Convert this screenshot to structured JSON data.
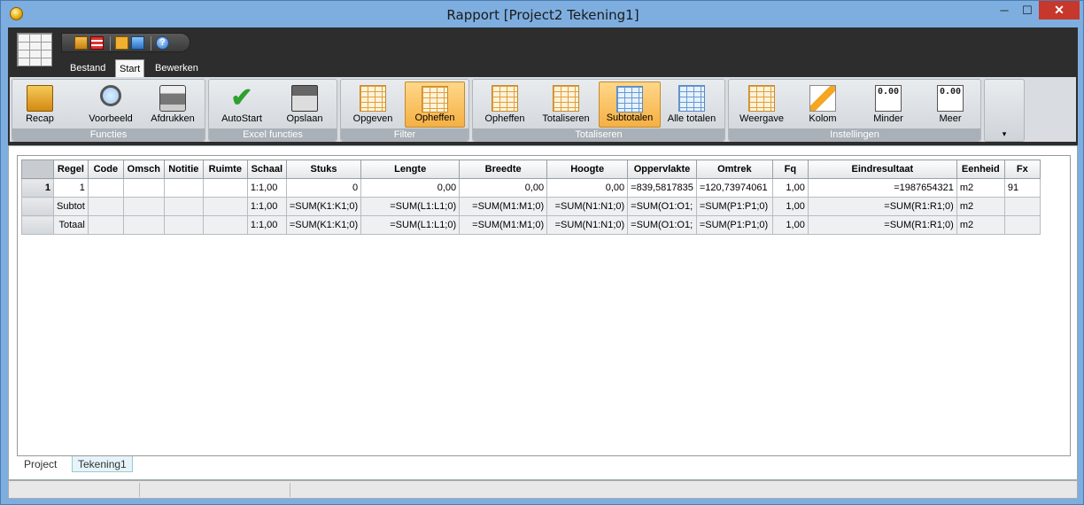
{
  "window": {
    "title": "Rapport  [Project2 Tekening1]",
    "min": "─",
    "max": "☐",
    "close": "✕"
  },
  "tabs": [
    "Bestand",
    "Start",
    "Bewerken"
  ],
  "active_tab": "Start",
  "groups": {
    "functies": {
      "label": "Functies",
      "buttons": [
        "Recap",
        "Voorbeeld",
        "Afdrukken"
      ]
    },
    "excel": {
      "label": "Excel functies",
      "buttons": [
        "AutoStart",
        "Opslaan"
      ]
    },
    "filter": {
      "label": "Filter",
      "buttons": [
        "Opgeven",
        "Opheffen"
      ]
    },
    "totaliseren": {
      "label": "Totaliseren",
      "buttons": [
        "Opheffen",
        "Totaliseren",
        "Subtotalen",
        "Alle totalen"
      ]
    },
    "instellingen": {
      "label": "Instellingen",
      "buttons": [
        "Weergave",
        "Kolom",
        "Minder",
        "Meer"
      ]
    }
  },
  "counter_icon": "0.00",
  "dropdown_arrow": "▾",
  "table": {
    "headers": [
      "",
      "Regel",
      "Code",
      "Omsch",
      "Notitie",
      "Ruimte",
      "Schaal",
      "Stuks",
      "Lengte",
      "Breedte",
      "Hoogte",
      "Oppervlakte",
      "Omtrek",
      "Fq",
      "Eindresultaat",
      "Eenheid",
      "Fx"
    ],
    "rows": [
      [
        "1",
        "1",
        "",
        "",
        "",
        "",
        "1:1,00",
        "0",
        "0,00",
        "0,00",
        "0,00",
        "=839,5817835",
        "=120,73974061",
        "1,00",
        "=1987654321",
        "m2",
        "91"
      ],
      [
        "",
        "Subtot",
        "",
        "",
        "",
        "",
        "1:1,00",
        "=SUM(K1:K1;0)",
        "=SUM(L1:L1;0)",
        "=SUM(M1:M1;0)",
        "=SUM(N1:N1;0)",
        "=SUM(O1:O1;",
        "=SUM(P1:P1;0)",
        "1,00",
        "=SUM(R1:R1;0)",
        "m2",
        ""
      ],
      [
        "",
        "Totaal",
        "",
        "",
        "",
        "",
        "1:1,00",
        "=SUM(K1:K1;0)",
        "=SUM(L1:L1;0)",
        "=SUM(M1:M1;0)",
        "=SUM(N1:N1;0)",
        "=SUM(O1:O1;",
        "=SUM(P1:P1;0)",
        "1,00",
        "=SUM(R1:R1;0)",
        "m2",
        ""
      ]
    ]
  },
  "sheet_tabs": [
    "Project",
    "Tekening1"
  ],
  "active_sheet": "Tekening1"
}
